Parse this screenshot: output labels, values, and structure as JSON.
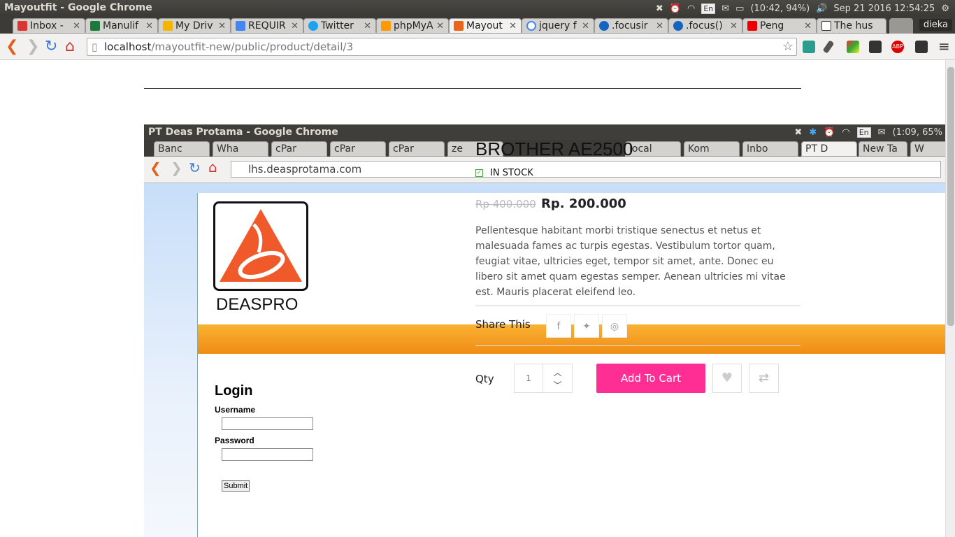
{
  "window": {
    "title": "Mayoutfit - Google Chrome",
    "tray": {
      "lang": "En",
      "battery": "(10:42, 94%)",
      "datetime": "Sep 21 2016 12:54:25"
    }
  },
  "tabs": [
    {
      "label": "Inbox - "
    },
    {
      "label": "Manulif"
    },
    {
      "label": "My Driv"
    },
    {
      "label": "REQUIR"
    },
    {
      "label": "Twitter"
    },
    {
      "label": "phpMyA"
    },
    {
      "label": "Mayout"
    },
    {
      "label": "jquery f"
    },
    {
      "label": ".focusir"
    },
    {
      "label": ".focus()"
    },
    {
      "label": "Peng"
    },
    {
      "label": "The hus"
    }
  ],
  "profile": "dieka",
  "address": {
    "host": "localhost",
    "path": "/mayoutfit-new/public/product/detail/3"
  },
  "embedded": {
    "title": "PT Deas Protama - Google Chrome",
    "tray": {
      "lang": "En",
      "battery": "(1:09, 65%"
    },
    "tabs": [
      {
        "label": "Banc"
      },
      {
        "label": "Wha"
      },
      {
        "label": "cPar"
      },
      {
        "label": "cPar"
      },
      {
        "label": "cPar"
      },
      {
        "label": "ze"
      },
      {
        "label": "local"
      },
      {
        "label": "Kom"
      },
      {
        "label": "Inbo"
      },
      {
        "label": "PT D"
      },
      {
        "label": "New Ta"
      },
      {
        "label": "W"
      }
    ],
    "address": "lhs.deasprotama.com",
    "logo_text": "DEASPRO",
    "login": {
      "title": "Login",
      "username_label": "Username",
      "password_label": "Password",
      "submit": "Submit"
    }
  },
  "product": {
    "title": "BROTHER AE2500",
    "stock": "IN STOCK",
    "old_price": "Rp 400.000",
    "price": "Rp. 200.000",
    "description": "Pellentesque habitant morbi tristique senectus et netus et malesuada fames ac turpis egestas. Vestibulum tortor quam, feugiat vitae, ultricies eget, tempor sit amet, ante. Donec eu libero sit amet quam egestas semper. Aenean ultricies mi vitae est. Mauris placerat eleifend leo.",
    "share_label": "Share This",
    "qty_label": "Qty",
    "qty_value": "1",
    "add_to_cart": "Add To Cart"
  }
}
